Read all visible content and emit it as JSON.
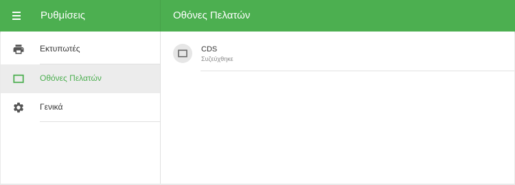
{
  "header": {
    "app_title": "Ρυθμίσεις",
    "page_title": "Οθόνες Πελατών"
  },
  "sidebar": {
    "items": [
      {
        "label": "Εκτυπωτές",
        "icon": "printer-icon",
        "active": false
      },
      {
        "label": "Οθόνες Πελατών",
        "icon": "display-icon",
        "active": true
      },
      {
        "label": "Γενικά",
        "icon": "gear-icon",
        "active": false
      }
    ]
  },
  "devices": [
    {
      "name": "CDS",
      "status": "Συζεύχθηκε",
      "icon": "display-icon"
    }
  ],
  "colors": {
    "accent": "#4caf50",
    "icon": "#555555",
    "active_bg": "#ececec"
  }
}
